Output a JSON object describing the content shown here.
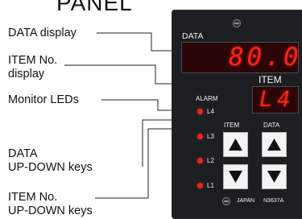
{
  "title": "PANEL",
  "callouts": {
    "data_display": "DATA display",
    "item_display_line1": "ITEM No.",
    "item_display_line2": "display",
    "monitor_leds": "Monitor LEDs",
    "data_keys_line1": "DATA",
    "data_keys_line2": "UP-DOWN keys",
    "item_keys_line1": "ITEM No.",
    "item_keys_line2": "UP-DOWN keys"
  },
  "panel": {
    "data_label": "DATA",
    "data_value": "80.0",
    "item_label": "ITEM",
    "item_value": "L4",
    "alarm_label": "ALARM",
    "leds": [
      {
        "label": "L4",
        "color": "#e8261c"
      },
      {
        "label": "L3",
        "color": "#e8261c"
      },
      {
        "label": "L2",
        "color": "#e8261c"
      },
      {
        "label": "L1",
        "color": "#e8261c"
      }
    ],
    "key_column_item": "ITEM",
    "key_column_data": "DATA",
    "footer_country": "JAPAN",
    "footer_model": "N3637A",
    "display_color": "#ff2418",
    "panel_color": "#1d1e22"
  }
}
